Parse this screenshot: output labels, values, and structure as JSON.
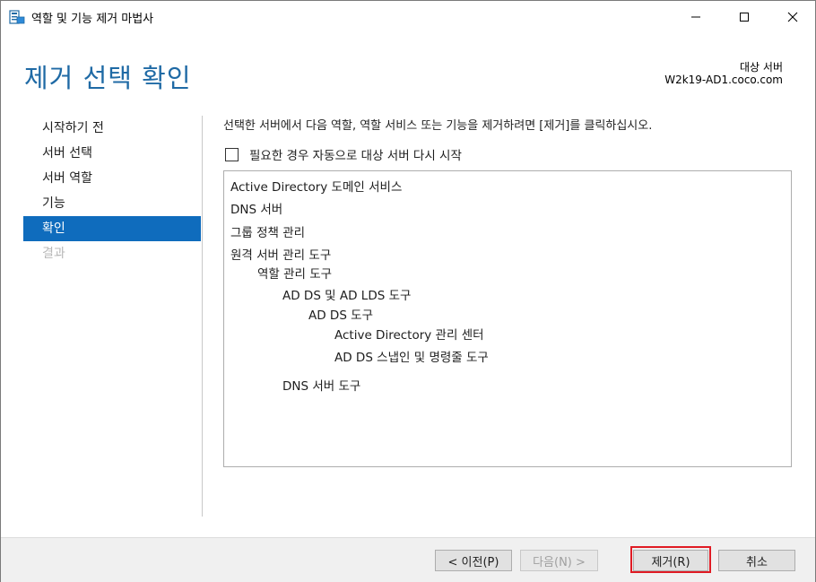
{
  "window": {
    "title": "역할 및 기능 제거 마법사",
    "icon": "server-manager-icon"
  },
  "header": {
    "page_title": "제거 선택 확인",
    "destination_label": "대상 서버",
    "destination_server": "W2k19-AD1.coco.com"
  },
  "nav": {
    "items": [
      {
        "label": "시작하기 전",
        "state": "normal"
      },
      {
        "label": "서버 선택",
        "state": "normal"
      },
      {
        "label": "서버 역할",
        "state": "normal"
      },
      {
        "label": "기능",
        "state": "normal"
      },
      {
        "label": "확인",
        "state": "active"
      },
      {
        "label": "결과",
        "state": "disabled"
      }
    ]
  },
  "main": {
    "instruction": "선택한 서버에서 다음 역할, 역할 서비스 또는 기능을 제거하려면 [제거]를 클릭하십시오.",
    "restart_checkbox_label": "필요한 경우 자동으로 대상 서버 다시 시작",
    "restart_checked": false,
    "removal_items": [
      {
        "label": "Active Directory 도메인 서비스",
        "level": 0
      },
      {
        "label": "DNS 서버",
        "level": 0
      },
      {
        "label": "그룹 정책 관리",
        "level": 0
      },
      {
        "label": "원격 서버 관리 도구",
        "level": 0
      },
      {
        "label": "역할 관리 도구",
        "level": 1
      },
      {
        "label": "AD DS 및 AD LDS 도구",
        "level": 2
      },
      {
        "label": "AD DS 도구",
        "level": 3
      },
      {
        "label": "Active Directory 관리 센터",
        "level": 4
      },
      {
        "label": "AD DS 스냅인 및 명령줄 도구",
        "level": 4
      },
      {
        "label": "DNS 서버 도구",
        "level": 2
      }
    ]
  },
  "footer": {
    "prev_label": "< 이전(P)",
    "next_label": "다음(N) >",
    "remove_label": "제거(R)",
    "cancel_label": "취소"
  },
  "colors": {
    "accent": "#0f6cbd",
    "title": "#1f6aa5",
    "highlight": "#e01b24"
  }
}
